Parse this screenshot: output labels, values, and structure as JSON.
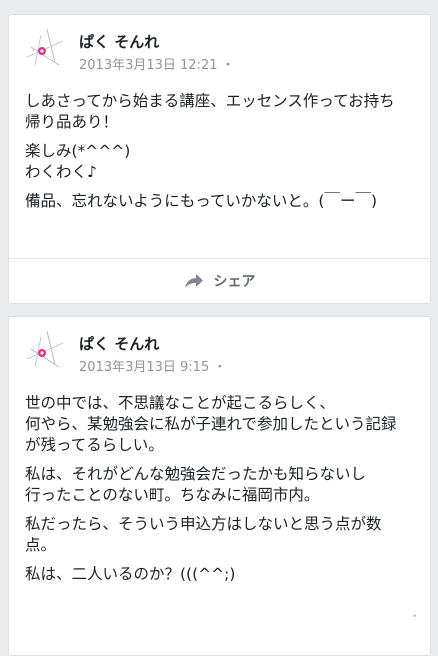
{
  "posts": [
    {
      "author": "ぱく そんれ",
      "timestamp": "2013年3月13日 12:21",
      "separator": "・",
      "paragraphs": [
        "しあさってから始まる講座、エッセンス作ってお持ち\n帰り品あり！",
        "楽しみ(*^^^)\nわくわく♪",
        "備品、忘れないようにもっていかないと。(￣ー￣)"
      ],
      "share_label": "シェア"
    },
    {
      "author": "ぱく そんれ",
      "timestamp": "2013年3月13日 9:15",
      "separator": "・",
      "paragraphs": [
        "世の中では、不思議なことが起こるらしく、\n何やら、某勉強会に私が子連れで参加したという記録\nが残ってるらしい。",
        "私は、それがどんな勉強会だったかも知らないし\n行ったことのない町。ちなみに福岡市内。",
        "私だったら、そういう申込方はしないと思う点が数\n点。",
        "私は、二人いるのか？(((^^;)"
      ]
    }
  ],
  "colors": {
    "background": "#e9ebee",
    "card": "#ffffff",
    "meta_text": "#90949c",
    "avatar_accent": "#e0308f"
  },
  "icons": {
    "avatar": "star-lines-avatar-icon",
    "share": "share-arrow-icon"
  }
}
